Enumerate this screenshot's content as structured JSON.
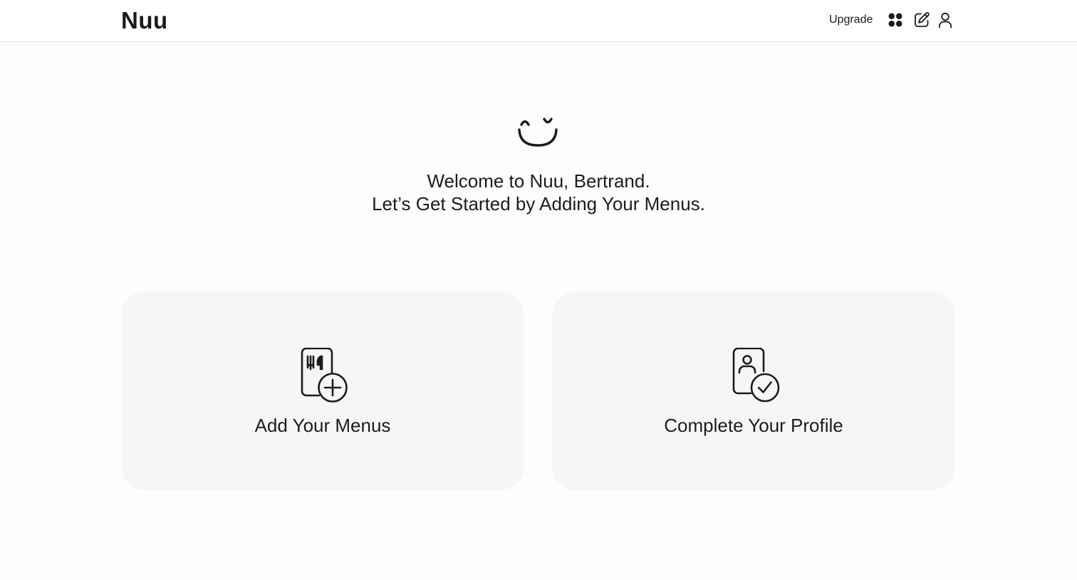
{
  "header": {
    "logo": "Nuu",
    "upgrade_label": "Upgrade",
    "icons": [
      "apps-grid-icon",
      "edit-icon",
      "user-icon"
    ]
  },
  "hero": {
    "icon": "smile-icon",
    "line1": "Welcome to Nuu, Bertrand.",
    "line2": "Let’s Get Started by Adding Your Menus."
  },
  "cards": [
    {
      "label": "Add Your Menus",
      "icon": "menu-add-icon"
    },
    {
      "label": "Complete Your Profile",
      "icon": "profile-check-icon"
    }
  ],
  "colors": {
    "text": "#1c1c1c",
    "card_bg": "#f6f6f6",
    "page_bg": "#fdfdfd",
    "header_border": "#ececec"
  }
}
